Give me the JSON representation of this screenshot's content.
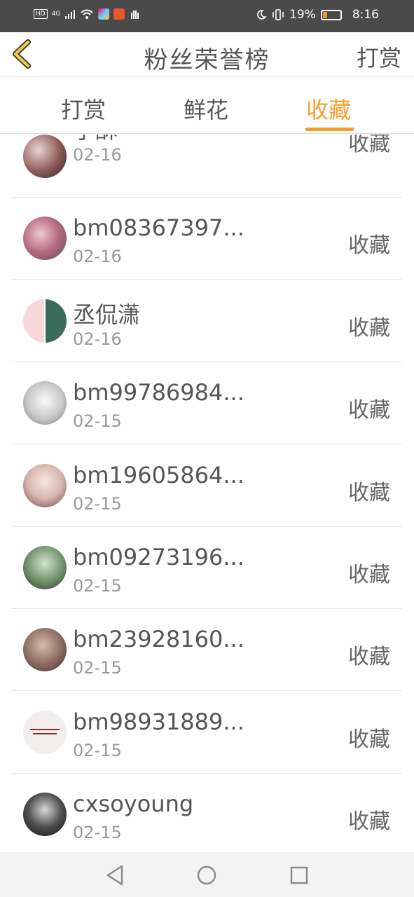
{
  "status_bar": {
    "network": "4G",
    "battery": "19%",
    "battery_level": 0.19,
    "time": "8:16"
  },
  "header": {
    "title": "粉丝荣誉榜",
    "action": "打赏"
  },
  "tabs": [
    {
      "label": "打赏",
      "active": false
    },
    {
      "label": "鲜花",
      "active": false
    },
    {
      "label": "收藏",
      "active": true
    }
  ],
  "colors": {
    "accent": "#f3a02e",
    "status_bar_bg": "#4a4a4a"
  },
  "fans": [
    {
      "name": "宁酥",
      "date": "02-16",
      "action": "收藏",
      "avatar": "photo"
    },
    {
      "name": "bm08367397...",
      "date": "02-16",
      "action": "收藏",
      "avatar": "photo"
    },
    {
      "name": "丞侃潇",
      "date": "02-16",
      "action": "收藏",
      "avatar": "photo"
    },
    {
      "name": "bm99786984...",
      "date": "02-15",
      "action": "收藏",
      "avatar": "lion-sketch"
    },
    {
      "name": "bm19605864...",
      "date": "02-15",
      "action": "收藏",
      "avatar": "photo"
    },
    {
      "name": "bm09273196...",
      "date": "02-15",
      "action": "收藏",
      "avatar": "photo"
    },
    {
      "name": "bm23928160...",
      "date": "02-15",
      "action": "收藏",
      "avatar": "photo"
    },
    {
      "name": "bm98931889...",
      "date": "02-15",
      "action": "收藏",
      "avatar": "text-image"
    },
    {
      "name": "cxsoyoung",
      "date": "02-15",
      "action": "收藏",
      "avatar": "photo"
    }
  ],
  "nav_bar": {
    "icons": [
      "back-triangle-icon",
      "home-circle-icon",
      "recents-square-icon"
    ]
  }
}
